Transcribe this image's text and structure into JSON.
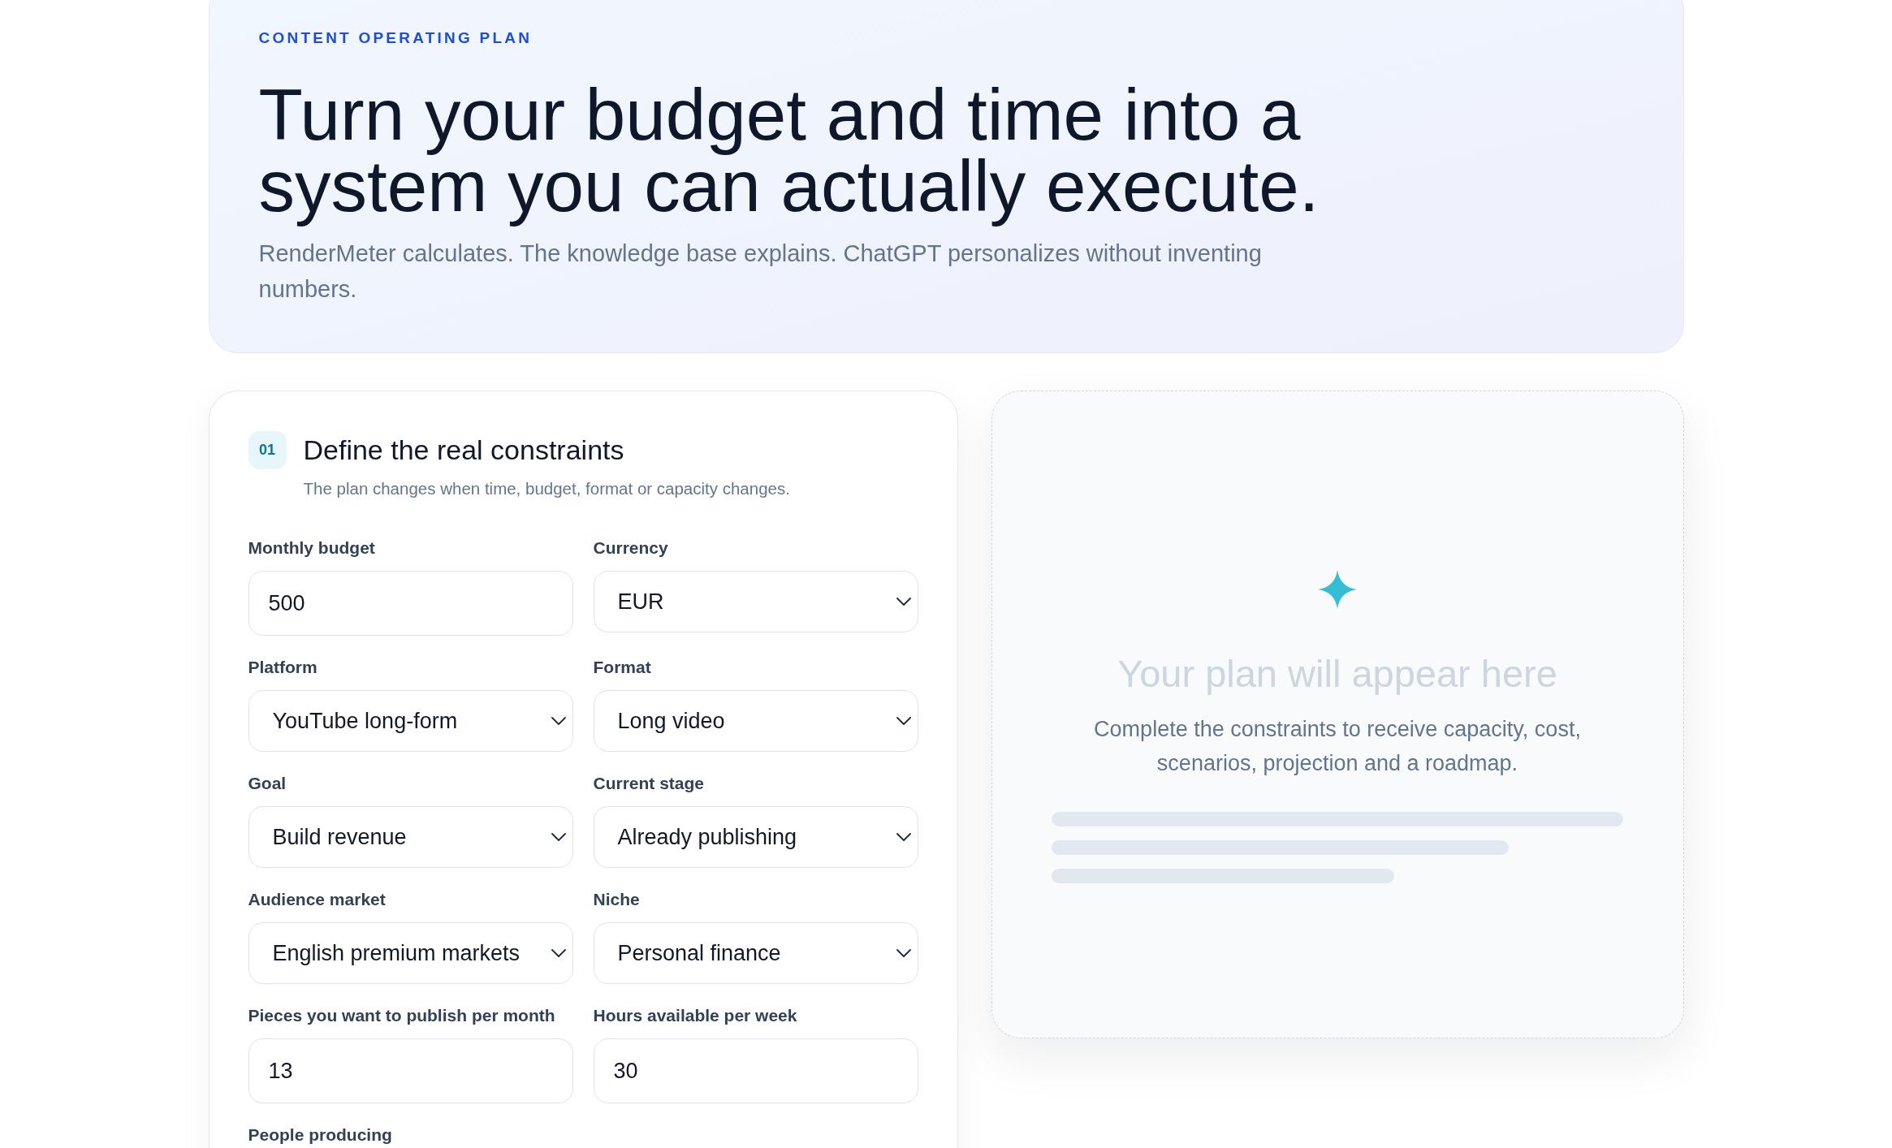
{
  "header": {
    "eyebrow": "CONTENT OPERATING PLAN",
    "title": "Turn your budget and time into a system you can actually execute.",
    "subtitle": "RenderMeter calculates. The knowledge base explains. ChatGPT personalizes without inventing numbers."
  },
  "constraints_panel": {
    "step": "01",
    "title": "Define the real constraints",
    "subtitle": "The plan changes when time, budget, format or capacity changes.",
    "fields": [
      {
        "label": "Monthly budget",
        "kind": "input",
        "value": "500"
      },
      {
        "label": "Currency",
        "kind": "select",
        "value": "EUR"
      },
      {
        "label": "Platform",
        "kind": "select",
        "value": "YouTube long-form"
      },
      {
        "label": "Format",
        "kind": "select",
        "value": "Long video"
      },
      {
        "label": "Goal",
        "kind": "select",
        "value": "Build revenue"
      },
      {
        "label": "Current stage",
        "kind": "select",
        "value": "Already publishing"
      },
      {
        "label": "Audience market",
        "kind": "select",
        "value": "English premium markets"
      },
      {
        "label": "Niche",
        "kind": "select",
        "value": "Personal finance"
      },
      {
        "label": "Pieces you want to publish per month",
        "kind": "input",
        "value": "13"
      },
      {
        "label": "Hours available per week",
        "kind": "input",
        "value": "30"
      }
    ],
    "partial_field": {
      "label": "People producing"
    }
  },
  "result_panel": {
    "title": "Your plan will appear here",
    "description": "Complete the constraints to receive capacity, cost, scenarios, projection and a roadmap."
  }
}
